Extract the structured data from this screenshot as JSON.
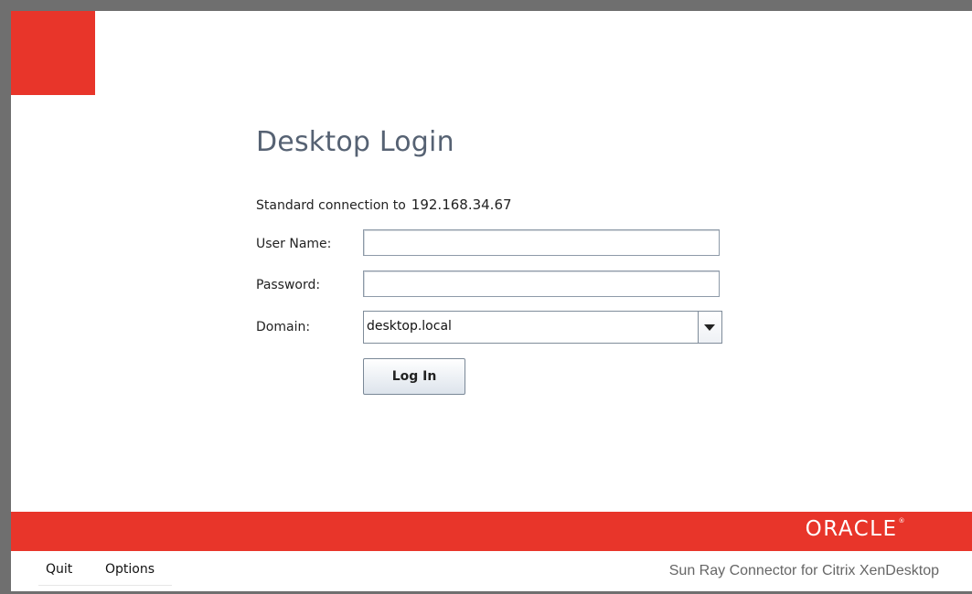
{
  "login": {
    "title": "Desktop Login",
    "connection_prefix": "Standard connection to",
    "server_ip": "192.168.34.67",
    "username_label": "User Name:",
    "username_value": "",
    "password_label": "Password:",
    "password_value": "",
    "domain_label": "Domain:",
    "domain_value": "desktop.local",
    "login_button": "Log In"
  },
  "branding": {
    "logo_text": "ORACLE",
    "trademark": "®",
    "product_name": "Sun Ray Connector for Citrix XenDesktop",
    "accent_color": "#e8352a",
    "title_color": "#566273"
  },
  "menu": {
    "quit": "Quit",
    "options": "Options"
  },
  "icons": {
    "combo_arrow": "chevron-down-icon"
  }
}
